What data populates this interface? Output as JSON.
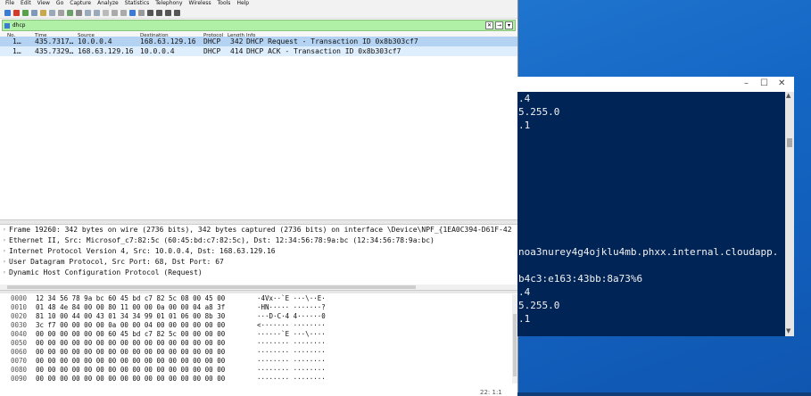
{
  "menu": [
    "File",
    "Edit",
    "View",
    "Go",
    "Capture",
    "Analyze",
    "Statistics",
    "Telephony",
    "Wireless",
    "Tools",
    "Help"
  ],
  "filter": {
    "value": "dhcp"
  },
  "columns": {
    "no": "No.",
    "time": "Time",
    "source": "Source",
    "destination": "Destination",
    "protocol": "Protocol",
    "length": "Length",
    "info": "Info"
  },
  "packets": [
    {
      "no": "1…",
      "time": "435.7317…",
      "source": "10.0.0.4",
      "destination": "168.63.129.16",
      "protocol": "DHCP",
      "length": "342",
      "info": "DHCP Request   - Transaction ID 0x8b303cf7"
    },
    {
      "no": "1…",
      "time": "435.7329…",
      "source": "168.63.129.16",
      "destination": "10.0.0.4",
      "protocol": "DHCP",
      "length": "414",
      "info": "DHCP ACK       - Transaction ID 0x8b303cf7"
    }
  ],
  "details": [
    "Frame 19260: 342 bytes on wire (2736 bits), 342 bytes captured (2736 bits) on interface \\Device\\NPF_{1EA0C394-D61F-42",
    "Ethernet II, Src: Microsof_c7:82:5c (60:45:bd:c7:82:5c), Dst: 12:34:56:78:9a:bc (12:34:56:78:9a:bc)",
    "Internet Protocol Version 4, Src: 10.0.0.4, Dst: 168.63.129.16",
    "User Datagram Protocol, Src Port: 68, Dst Port: 67",
    "Dynamic Host Configuration Protocol (Request)"
  ],
  "bytes": [
    {
      "off": "0000",
      "hex": "12 34 56 78 9a bc 60 45  bd c7 82 5c 08 00 45 00",
      "ascii": "·4Vx··`E ···\\··E·"
    },
    {
      "off": "0010",
      "hex": "01 48 4e 84 00 00 80 11  00 00 0a 00 00 04 a8 3f",
      "ascii": "·HN····· ·······?"
    },
    {
      "off": "0020",
      "hex": "81 10 00 44 00 43 01 34  34 99 01 01 06 00 8b 30",
      "ascii": "···D·C·4 4······0"
    },
    {
      "off": "0030",
      "hex": "3c f7 00 00 00 00 0a 00  00 04 00 00 00 00 00 00",
      "ascii": "<······· ········"
    },
    {
      "off": "0040",
      "hex": "00 00 00 00 00 00 60 45  bd c7 82 5c 00 00 00 00",
      "ascii": "······`E ···\\····"
    },
    {
      "off": "0050",
      "hex": "00 00 00 00 00 00 00 00  00 00 00 00 00 00 00 00",
      "ascii": "········ ········"
    },
    {
      "off": "0060",
      "hex": "00 00 00 00 00 00 00 00  00 00 00 00 00 00 00 00",
      "ascii": "········ ········"
    },
    {
      "off": "0070",
      "hex": "00 00 00 00 00 00 00 00  00 00 00 00 00 00 00 00",
      "ascii": "········ ········"
    },
    {
      "off": "0080",
      "hex": "00 00 00 00 00 00 00 00  00 00 00 00 00 00 00 00",
      "ascii": "········ ········"
    },
    {
      "off": "0090",
      "hex": "00 00 00 00 00 00 00 00  00 00 00 00 00 00 00 00",
      "ascii": "········ ········"
    }
  ],
  "status_fragment": "22: 1:1",
  "powershell": {
    "lines": [
      ".4",
      "5.255.0",
      ".1",
      "noa3nurey4g4ojklu4mb.phxx.internal.cloudapp.",
      "b4c3:e163:43bb:8a73%6",
      ".4",
      "5.255.0",
      ".1"
    ]
  },
  "colors": {
    "selected_row": "#b4d3f3",
    "filter_bg": "#b0f0a6",
    "powershell_bg": "#012456",
    "desktop": "#1466c4"
  }
}
